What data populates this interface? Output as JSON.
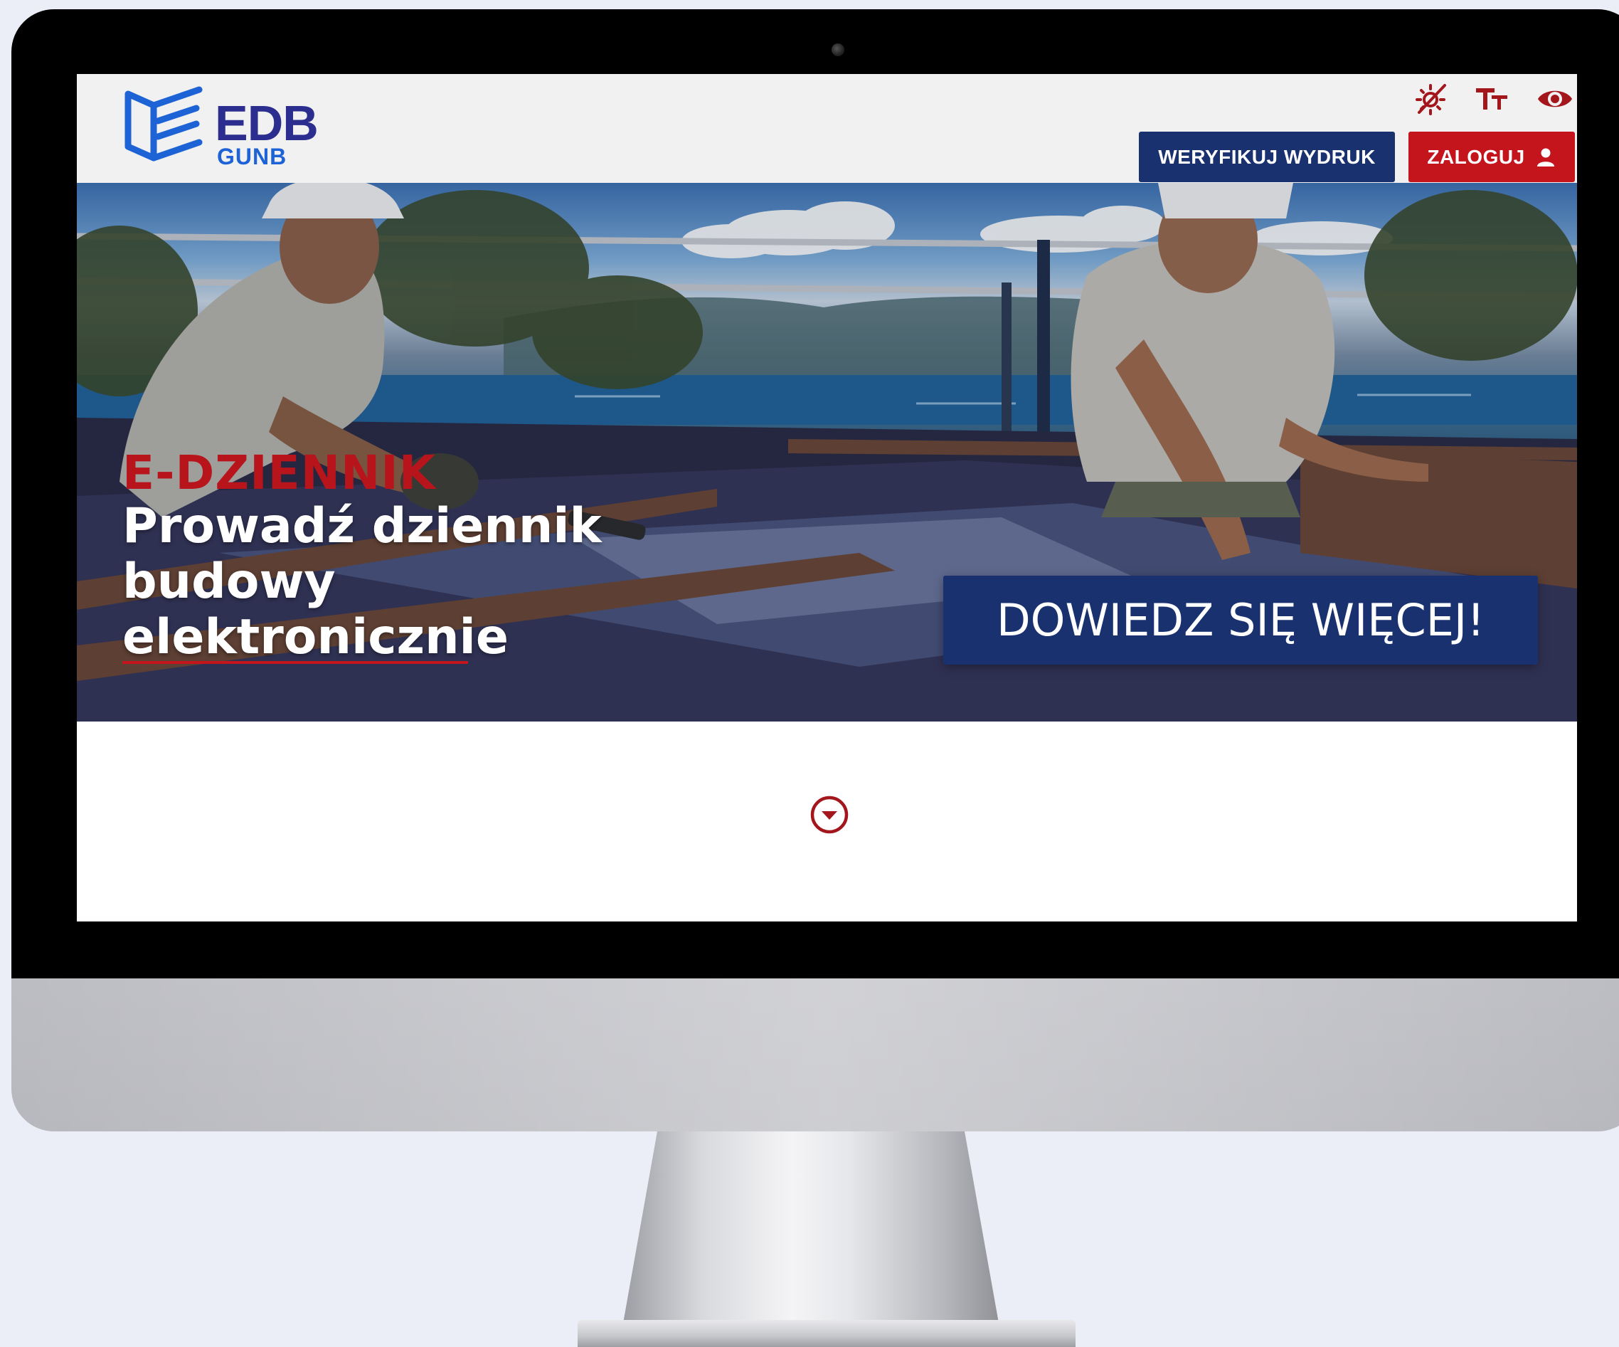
{
  "brand": {
    "title": "EDB",
    "subtitle": "GUNB",
    "primary_color": "#2b2e8f",
    "secondary_color": "#1e63d6"
  },
  "accessibility_toolbar": {
    "icons": [
      "contrast-off-icon",
      "text-size-icon",
      "eye-icon"
    ],
    "icon_color": "#a3161c"
  },
  "header": {
    "verify_button_label": "WERYFIKUJ WYDRUK",
    "login_button_label": "ZALOGUJ",
    "verify_color": "#1a3170",
    "login_color": "#c4141c"
  },
  "hero": {
    "kicker": "E-DZIENNIK",
    "title_lines": [
      "Prowadź dziennik",
      "budowy",
      "elektronicznie"
    ],
    "cta_label": "DOWIEDZ SIĘ WIĘCEJ!"
  },
  "scroll_icon": "chevron-down-circle-icon"
}
